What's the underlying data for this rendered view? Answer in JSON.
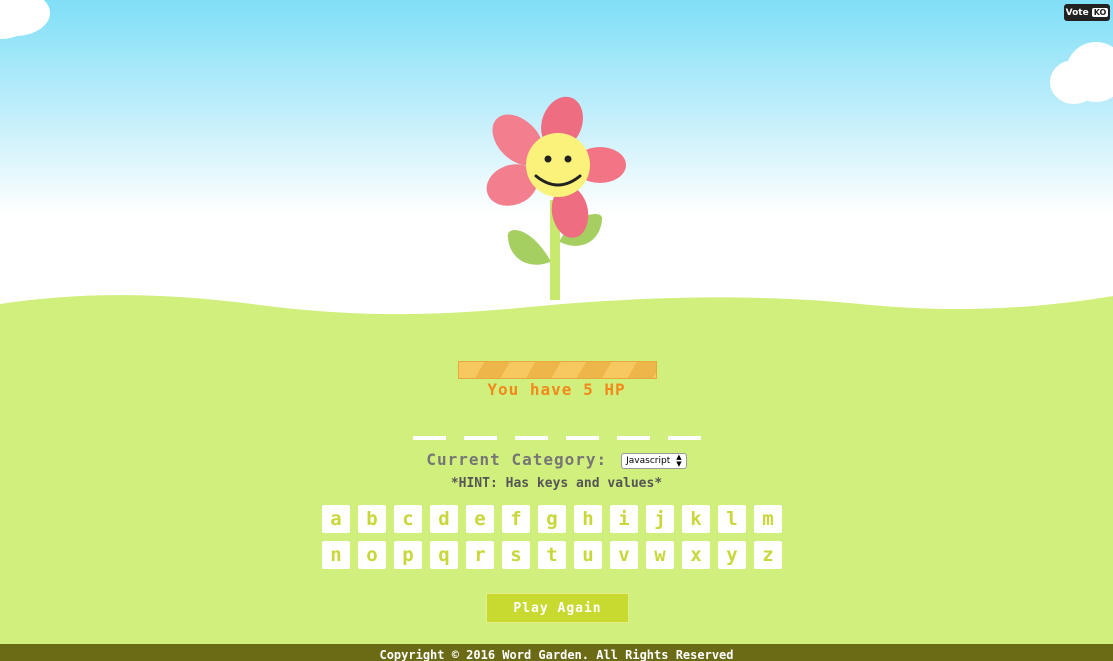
{
  "vote_badge": {
    "label": "Vote",
    "badge": "KO"
  },
  "hp": {
    "value": 5,
    "text": "You have 5 HP",
    "fill_fraction": 1.0
  },
  "word": {
    "letter_count": 6
  },
  "category": {
    "label": "Current Category:",
    "selected": "Javascript"
  },
  "hint": "*HINT: Has keys and values*",
  "keyboard": {
    "row1": [
      "a",
      "b",
      "c",
      "d",
      "e",
      "f",
      "g",
      "h",
      "i",
      "j",
      "k",
      "l",
      "m"
    ],
    "row2": [
      "n",
      "o",
      "p",
      "q",
      "r",
      "s",
      "t",
      "u",
      "v",
      "w",
      "x",
      "y",
      "z"
    ]
  },
  "play_again_label": "Play Again",
  "footer_text": "Copyright © 2016 Word Garden. All Rights Reserved",
  "colors": {
    "sky_top": "#7fdff7",
    "grass": "#d1ef7c",
    "petal": "#f06f82",
    "face": "#fbf27c",
    "hp_text": "#f3891c",
    "key_text": "#c8d83a",
    "button": "#c8d930",
    "footer": "#6b6b16"
  }
}
